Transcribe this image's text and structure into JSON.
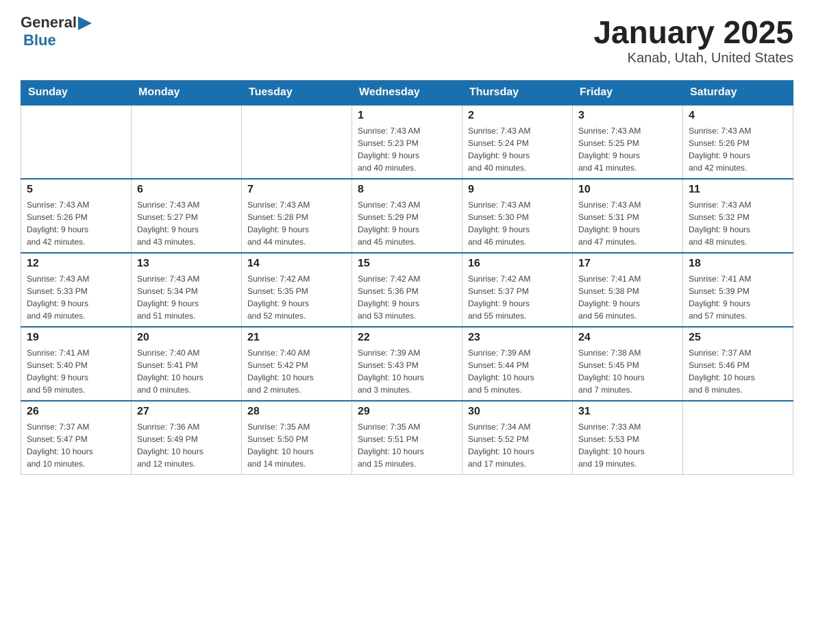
{
  "header": {
    "logo_general": "General",
    "logo_blue": "Blue",
    "title": "January 2025",
    "subtitle": "Kanab, Utah, United States"
  },
  "calendar": {
    "days_of_week": [
      "Sunday",
      "Monday",
      "Tuesday",
      "Wednesday",
      "Thursday",
      "Friday",
      "Saturday"
    ],
    "weeks": [
      [
        {
          "day": "",
          "info": ""
        },
        {
          "day": "",
          "info": ""
        },
        {
          "day": "",
          "info": ""
        },
        {
          "day": "1",
          "info": "Sunrise: 7:43 AM\nSunset: 5:23 PM\nDaylight: 9 hours\nand 40 minutes."
        },
        {
          "day": "2",
          "info": "Sunrise: 7:43 AM\nSunset: 5:24 PM\nDaylight: 9 hours\nand 40 minutes."
        },
        {
          "day": "3",
          "info": "Sunrise: 7:43 AM\nSunset: 5:25 PM\nDaylight: 9 hours\nand 41 minutes."
        },
        {
          "day": "4",
          "info": "Sunrise: 7:43 AM\nSunset: 5:26 PM\nDaylight: 9 hours\nand 42 minutes."
        }
      ],
      [
        {
          "day": "5",
          "info": "Sunrise: 7:43 AM\nSunset: 5:26 PM\nDaylight: 9 hours\nand 42 minutes."
        },
        {
          "day": "6",
          "info": "Sunrise: 7:43 AM\nSunset: 5:27 PM\nDaylight: 9 hours\nand 43 minutes."
        },
        {
          "day": "7",
          "info": "Sunrise: 7:43 AM\nSunset: 5:28 PM\nDaylight: 9 hours\nand 44 minutes."
        },
        {
          "day": "8",
          "info": "Sunrise: 7:43 AM\nSunset: 5:29 PM\nDaylight: 9 hours\nand 45 minutes."
        },
        {
          "day": "9",
          "info": "Sunrise: 7:43 AM\nSunset: 5:30 PM\nDaylight: 9 hours\nand 46 minutes."
        },
        {
          "day": "10",
          "info": "Sunrise: 7:43 AM\nSunset: 5:31 PM\nDaylight: 9 hours\nand 47 minutes."
        },
        {
          "day": "11",
          "info": "Sunrise: 7:43 AM\nSunset: 5:32 PM\nDaylight: 9 hours\nand 48 minutes."
        }
      ],
      [
        {
          "day": "12",
          "info": "Sunrise: 7:43 AM\nSunset: 5:33 PM\nDaylight: 9 hours\nand 49 minutes."
        },
        {
          "day": "13",
          "info": "Sunrise: 7:43 AM\nSunset: 5:34 PM\nDaylight: 9 hours\nand 51 minutes."
        },
        {
          "day": "14",
          "info": "Sunrise: 7:42 AM\nSunset: 5:35 PM\nDaylight: 9 hours\nand 52 minutes."
        },
        {
          "day": "15",
          "info": "Sunrise: 7:42 AM\nSunset: 5:36 PM\nDaylight: 9 hours\nand 53 minutes."
        },
        {
          "day": "16",
          "info": "Sunrise: 7:42 AM\nSunset: 5:37 PM\nDaylight: 9 hours\nand 55 minutes."
        },
        {
          "day": "17",
          "info": "Sunrise: 7:41 AM\nSunset: 5:38 PM\nDaylight: 9 hours\nand 56 minutes."
        },
        {
          "day": "18",
          "info": "Sunrise: 7:41 AM\nSunset: 5:39 PM\nDaylight: 9 hours\nand 57 minutes."
        }
      ],
      [
        {
          "day": "19",
          "info": "Sunrise: 7:41 AM\nSunset: 5:40 PM\nDaylight: 9 hours\nand 59 minutes."
        },
        {
          "day": "20",
          "info": "Sunrise: 7:40 AM\nSunset: 5:41 PM\nDaylight: 10 hours\nand 0 minutes."
        },
        {
          "day": "21",
          "info": "Sunrise: 7:40 AM\nSunset: 5:42 PM\nDaylight: 10 hours\nand 2 minutes."
        },
        {
          "day": "22",
          "info": "Sunrise: 7:39 AM\nSunset: 5:43 PM\nDaylight: 10 hours\nand 3 minutes."
        },
        {
          "day": "23",
          "info": "Sunrise: 7:39 AM\nSunset: 5:44 PM\nDaylight: 10 hours\nand 5 minutes."
        },
        {
          "day": "24",
          "info": "Sunrise: 7:38 AM\nSunset: 5:45 PM\nDaylight: 10 hours\nand 7 minutes."
        },
        {
          "day": "25",
          "info": "Sunrise: 7:37 AM\nSunset: 5:46 PM\nDaylight: 10 hours\nand 8 minutes."
        }
      ],
      [
        {
          "day": "26",
          "info": "Sunrise: 7:37 AM\nSunset: 5:47 PM\nDaylight: 10 hours\nand 10 minutes."
        },
        {
          "day": "27",
          "info": "Sunrise: 7:36 AM\nSunset: 5:49 PM\nDaylight: 10 hours\nand 12 minutes."
        },
        {
          "day": "28",
          "info": "Sunrise: 7:35 AM\nSunset: 5:50 PM\nDaylight: 10 hours\nand 14 minutes."
        },
        {
          "day": "29",
          "info": "Sunrise: 7:35 AM\nSunset: 5:51 PM\nDaylight: 10 hours\nand 15 minutes."
        },
        {
          "day": "30",
          "info": "Sunrise: 7:34 AM\nSunset: 5:52 PM\nDaylight: 10 hours\nand 17 minutes."
        },
        {
          "day": "31",
          "info": "Sunrise: 7:33 AM\nSunset: 5:53 PM\nDaylight: 10 hours\nand 19 minutes."
        },
        {
          "day": "",
          "info": ""
        }
      ]
    ]
  }
}
